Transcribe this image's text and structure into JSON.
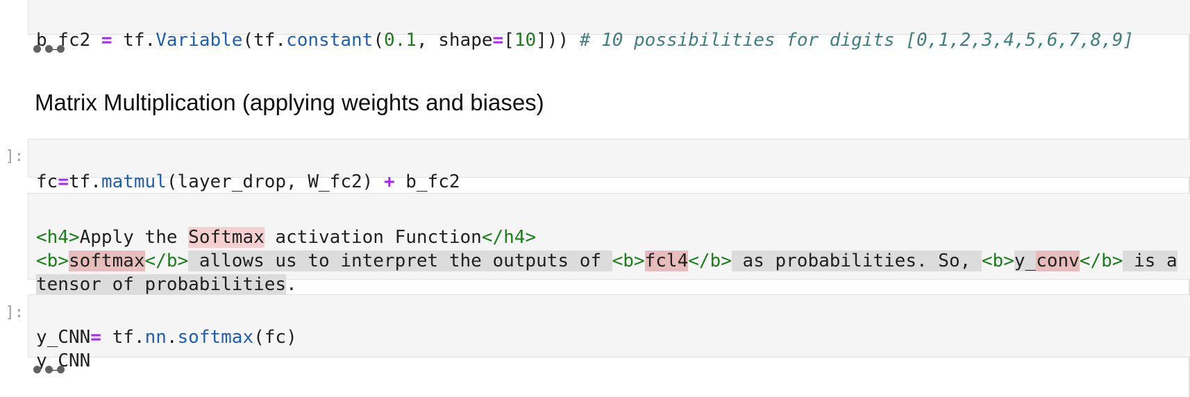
{
  "cell_top": {
    "line1": {
      "v": "b_fc2",
      "eq": " = ",
      "tf": "tf.",
      "variable": "Variable",
      "paren_open": "(tf.",
      "constant": "constant",
      "paren2": "(",
      "num": "0.1",
      "comma": ", shape",
      "eq2": "=",
      "bracket_open": "[",
      "num2": "10",
      "close": "])) ",
      "comment": "# 10 possibilities for digits [0,1,2,3,4,5,6,7,8,9]"
    }
  },
  "heading": "Matrix Multiplication (applying weights and biases)",
  "cell_matmul": {
    "prompt": "]:",
    "fc": "fc",
    "eq": "=",
    "tf": "tf.",
    "matmul": "matmul",
    "args": "(layer_drop, W_fc2) ",
    "plus": "+",
    "rest": " b_fc2"
  },
  "md_cell": {
    "line1_open": "<h4>",
    "line1_text_a": "Apply the ",
    "line1_softmax": "Softmax",
    "line1_text_b": " activation Function",
    "line1_close": "</h4>",
    "line2_b_open": "<b>",
    "line2_softmax": "softmax",
    "line2_b_close": "</b>",
    "line2_text_a": " allows us to interpret the outputs of ",
    "line2_b_open2": "<b>",
    "line2_fcl4": "fcl4",
    "line2_b_close2": "</b>",
    "line2_text_b": " as probabilities. So, ",
    "line2_b_open3": "<b>",
    "line2_y": "y_",
    "line2_conv": "conv",
    "line2_b_close3": "</b>",
    "line2_text_c": " is a",
    "line3_text": "tensor of probabilities",
    "line3_dot": "."
  },
  "cell_softmax": {
    "prompt": "]:",
    "line1_var": "y_CNN",
    "line1_eq": "=",
    "line1_tf": " tf.",
    "line1_nn": "nn",
    "line1_dot": ".",
    "line1_softmax": "softmax",
    "line1_args": "(fc)",
    "line2": "y_CNN"
  }
}
